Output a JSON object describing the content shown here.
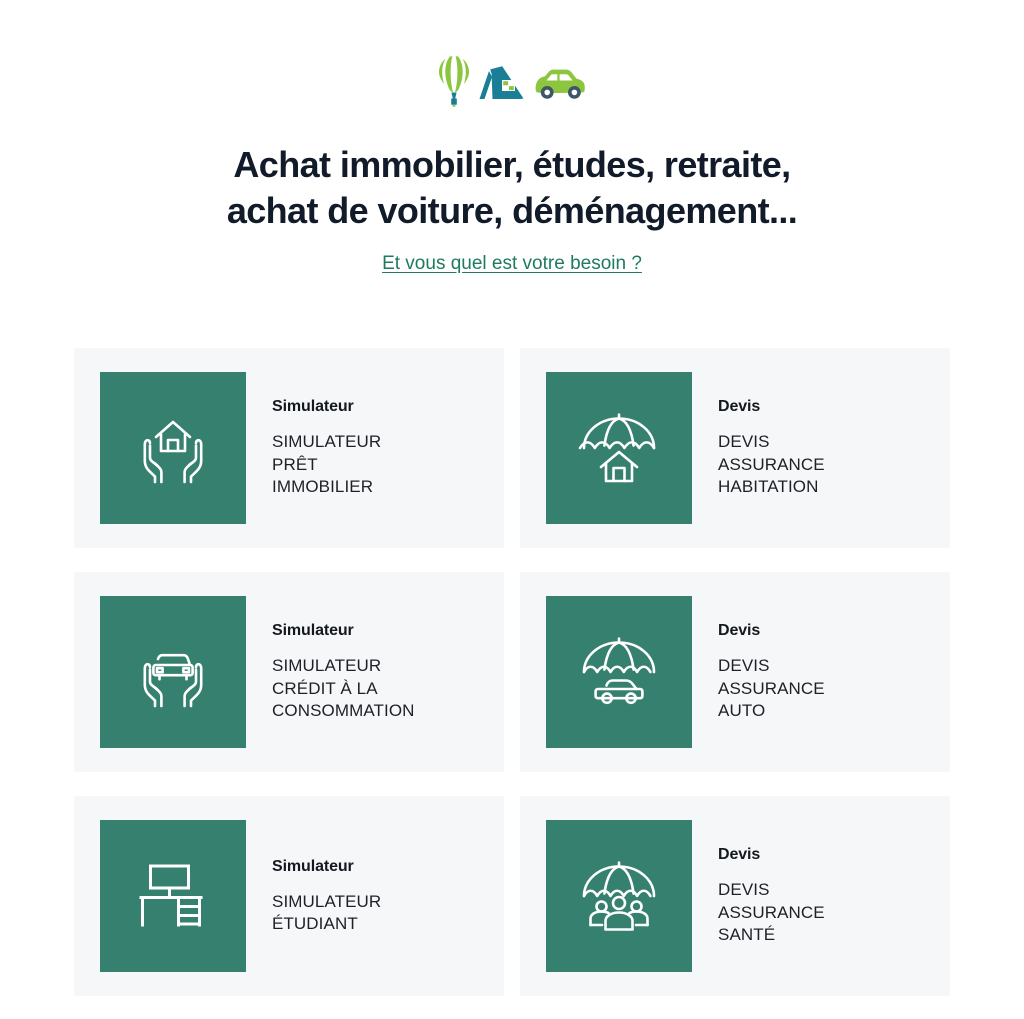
{
  "hero": {
    "icons": [
      {
        "name": "hot-air-balloon-icon",
        "label": "montgolfière"
      },
      {
        "name": "house-icon",
        "label": "maison"
      },
      {
        "name": "car-icon",
        "label": "voiture"
      }
    ],
    "title": "Achat immobilier, études, retraite,\nachat de voiture, déménagement...",
    "title_line1": "Achat immobilier, études, retraite,",
    "title_line2": "achat de voiture, déménagement...",
    "link_text": "Et vous quel est votre besoin ?"
  },
  "colors": {
    "teal": "#35806E",
    "green": "#8CC63E",
    "blue_teal": "#1A7E96",
    "link_green": "#1E7B60",
    "title_navy": "#121B2A",
    "card_bg": "#F5F7F9",
    "page_bg": "#FFFFFF"
  },
  "cards": [
    {
      "kicker": "Simulateur",
      "label": "SIMULATEUR\nPRÊT\nIMMOBILIER",
      "icon": "hands-holding-house-icon"
    },
    {
      "kicker": "Devis",
      "label": "DEVIS\nASSURANCE\nHABITATION",
      "icon": "umbrella-over-house-icon"
    },
    {
      "kicker": "Simulateur",
      "label": "SIMULATEUR\nCRÉDIT À LA\nCONSOMMATION",
      "icon": "hands-holding-car-icon"
    },
    {
      "kicker": "Devis",
      "label": "DEVIS\nASSURANCE\nAUTO",
      "icon": "umbrella-over-car-icon"
    },
    {
      "kicker": "Simulateur",
      "label": "SIMULATEUR\nÉTUDIANT",
      "icon": "desk-icon"
    },
    {
      "kicker": "Devis",
      "label": "DEVIS\nASSURANCE\nSANTÉ",
      "icon": "umbrella-over-people-icon"
    }
  ]
}
